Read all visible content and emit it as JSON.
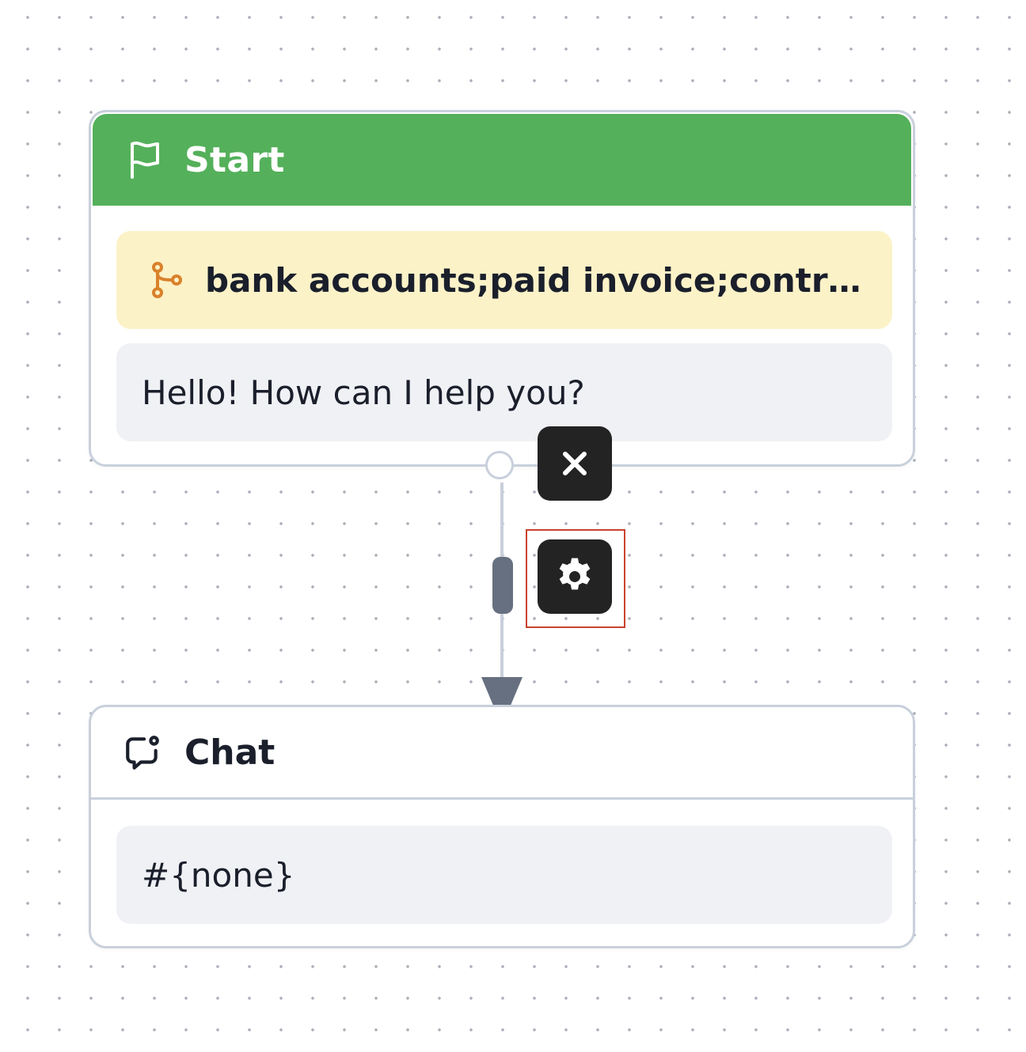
{
  "canvas": {
    "background_color": "#ffffff",
    "dot_color": "#a9aeb7"
  },
  "start_node": {
    "title": "Start",
    "header_color": "#54b05a",
    "icon": "flag-icon",
    "condition": {
      "icon": "git-branch-icon",
      "icon_color": "#d9822b",
      "text": "bank accounts;paid invoice;contra..."
    },
    "message": "Hello! How can I help you?"
  },
  "chat_node": {
    "title": "Chat",
    "icon": "message-circle-icon",
    "body": "#{none}"
  },
  "edge": {
    "delete_icon": "close-icon",
    "settings_icon": "gear-icon",
    "focus_color": "#c9432e"
  }
}
